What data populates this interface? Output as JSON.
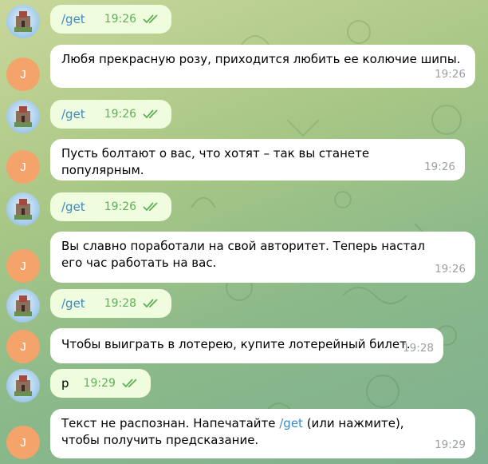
{
  "messages": [
    {
      "type": "out",
      "text": "/get",
      "time": "19:26",
      "is_command": true
    },
    {
      "type": "in",
      "text": "Любя прекрасную розу, приходится любить ее колючие шипы.",
      "time": "19:26",
      "avatar": "J"
    },
    {
      "type": "out",
      "text": "/get",
      "time": "19:26",
      "is_command": true
    },
    {
      "type": "in",
      "text": "Пусть болтают о вас, что хотят – так вы станете популярным.",
      "time": "19:26",
      "avatar": "J"
    },
    {
      "type": "out",
      "text": "/get",
      "time": "19:26",
      "is_command": true
    },
    {
      "type": "in",
      "text": "Вы славно поработали на свой авторитет. Теперь настал его час работать на вас.",
      "time": "19:26",
      "avatar": "J"
    },
    {
      "type": "out",
      "text": "/get",
      "time": "19:28",
      "is_command": true
    },
    {
      "type": "in",
      "text": "Чтобы выиграть в лотерею, купите лотерейный билет.",
      "time": "19:28",
      "avatar": "J"
    },
    {
      "type": "out",
      "text": "р",
      "time": "19:29",
      "is_command": false
    },
    {
      "type": "in",
      "text_before": "Текст не распознан. Напечатайте ",
      "command": "/get",
      "text_after": " (или нажмите), чтобы получить предсказание.",
      "time": "19:29",
      "avatar": "J"
    }
  ],
  "colors": {
    "outgoing_bubble": "#effdde",
    "incoming_bubble": "#ffffff",
    "command_link": "#3a8ac8",
    "outgoing_time": "#5eaf57",
    "incoming_time": "#9aa0a6",
    "user_avatar": "#f4a36b"
  },
  "icons": {
    "read_receipt": "double-check-icon",
    "bot_avatar": "castle-avatar"
  }
}
